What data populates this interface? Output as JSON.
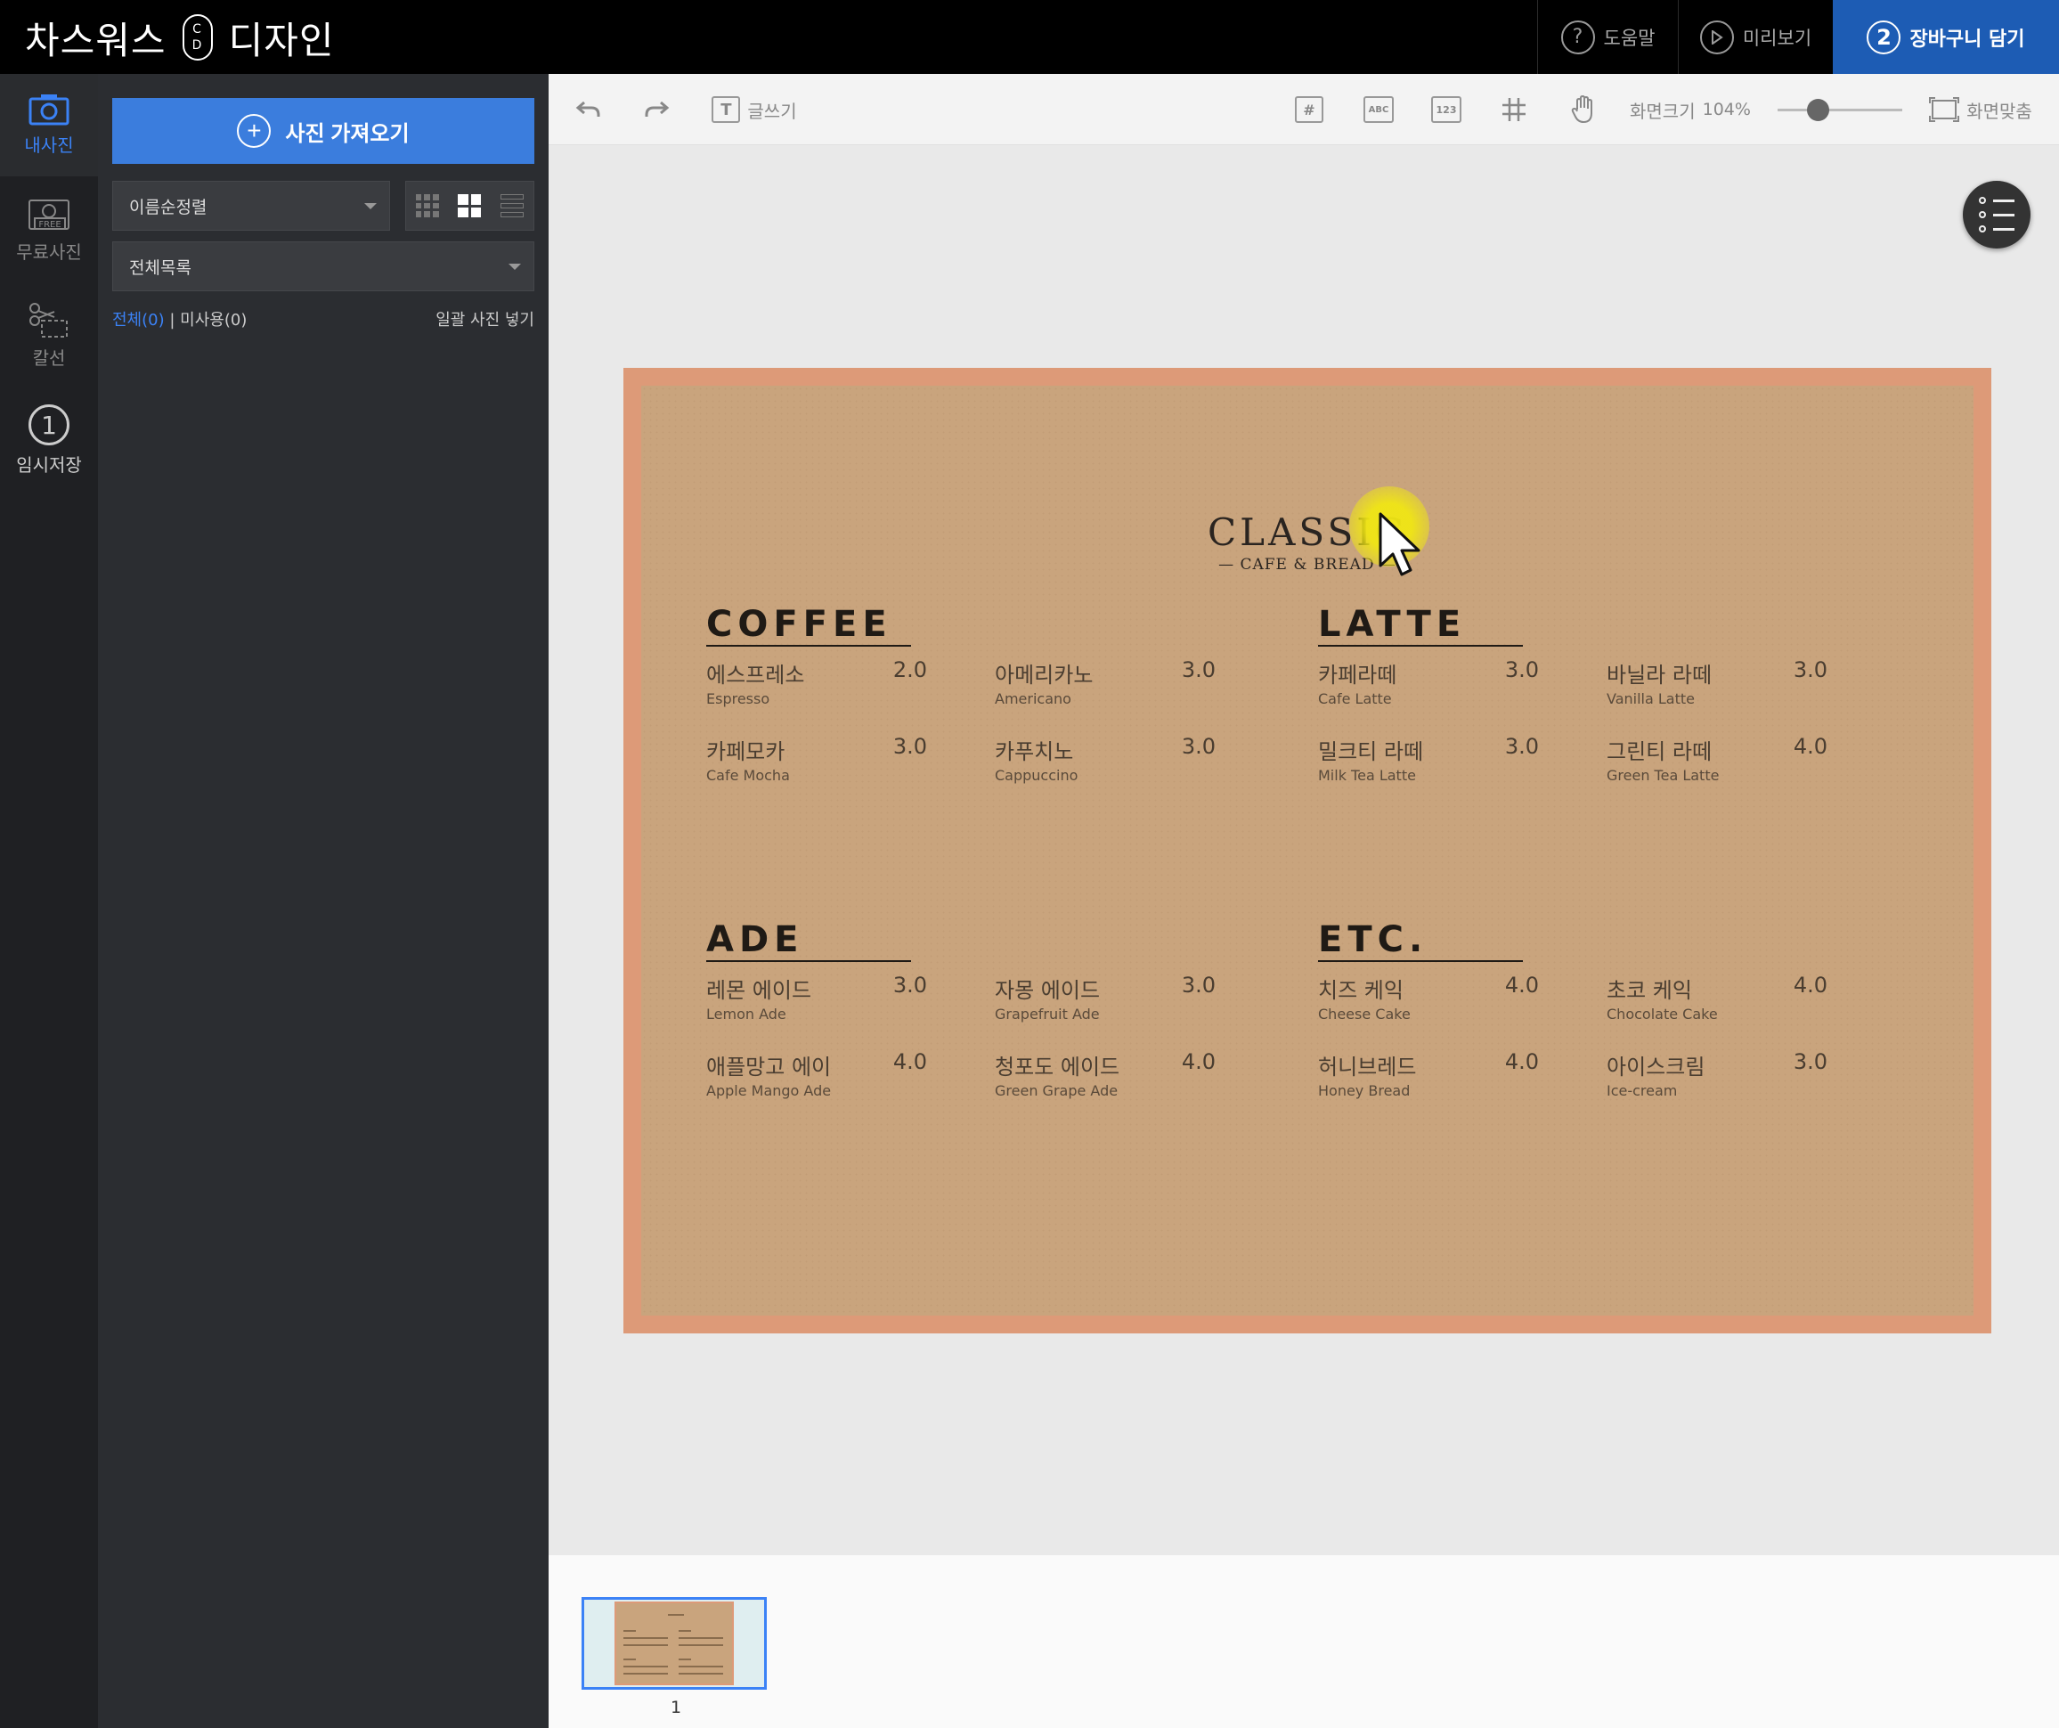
{
  "app": {
    "logo_left": "차스워스",
    "logo_badge_top": "C",
    "logo_badge_bottom": "D",
    "logo_right": "디자인"
  },
  "topbar": {
    "help": "도움말",
    "help_icon": "?",
    "preview": "미리보기",
    "cart_step": "2",
    "cart": "장바구니 담기"
  },
  "rail": {
    "my_photos": "내사진",
    "free_photos": "무료사진",
    "free_badge": "FREE",
    "cutline": "칼선",
    "temp_save_num": "1",
    "temp_save": "임시저장"
  },
  "panel": {
    "import_button": "사진 가져오기",
    "sort_select": "이름순정렬",
    "category_select": "전체목록",
    "filter_all": "전체(0)",
    "filter_sep": "|",
    "filter_unused": "미사용(0)",
    "bulk_insert": "일괄 사진 넣기"
  },
  "toolbar": {
    "write_text": "글쓰기",
    "text_icon": "T",
    "abc_label": "ABC",
    "num_label": "123",
    "hash_label": "#",
    "zoom_label": "화면크기",
    "zoom_value": "104%",
    "zoom_level_percent": 104,
    "fit_screen": "화면맞춤"
  },
  "menu": {
    "brand_title": "CLASSIC",
    "brand_sub": "— CAFE & BREAD —",
    "sections": [
      {
        "title": "COFFEE",
        "items": [
          {
            "ko": "에스프레소",
            "en": "Espresso",
            "price": "2.0"
          },
          {
            "ko": "아메리카노",
            "en": "Americano",
            "price": "3.0"
          },
          {
            "ko": "카페모카",
            "en": "Cafe Mocha",
            "price": "3.0"
          },
          {
            "ko": "카푸치노",
            "en": "Cappuccino",
            "price": "3.0"
          }
        ]
      },
      {
        "title": "LATTE",
        "items": [
          {
            "ko": "카페라떼",
            "en": "Cafe Latte",
            "price": "3.0"
          },
          {
            "ko": "바닐라 라떼",
            "en": "Vanilla Latte",
            "price": "3.0"
          },
          {
            "ko": "밀크티 라떼",
            "en": "Milk Tea Latte",
            "price": "3.0"
          },
          {
            "ko": "그린티 라떼",
            "en": "Green Tea Latte",
            "price": "4.0"
          }
        ]
      },
      {
        "title": "ADE",
        "items": [
          {
            "ko": "레몬 에이드",
            "en": "Lemon Ade",
            "price": "3.0"
          },
          {
            "ko": "자몽 에이드",
            "en": "Grapefruit Ade",
            "price": "3.0"
          },
          {
            "ko": "애플망고 에이",
            "en": "Apple Mango Ade",
            "price": "4.0"
          },
          {
            "ko": "청포도 에이드",
            "en": "Green Grape Ade",
            "price": "4.0"
          }
        ]
      },
      {
        "title": "ETC.",
        "items": [
          {
            "ko": "치즈 케익",
            "en": "Cheese Cake",
            "price": "4.0"
          },
          {
            "ko": "초코 케익",
            "en": "Chocolate Cake",
            "price": "4.0"
          },
          {
            "ko": "허니브레드",
            "en": "Honey Bread",
            "price": "4.0"
          },
          {
            "ko": "아이스크림",
            "en": "Ice-cream",
            "price": "3.0"
          }
        ]
      }
    ]
  },
  "pages": {
    "current": "1"
  },
  "colors": {
    "accent": "#3b7ddd",
    "cart_bg": "#1d5cb4",
    "menu_border": "#dd9a78",
    "kraft": "#c9a47d"
  }
}
